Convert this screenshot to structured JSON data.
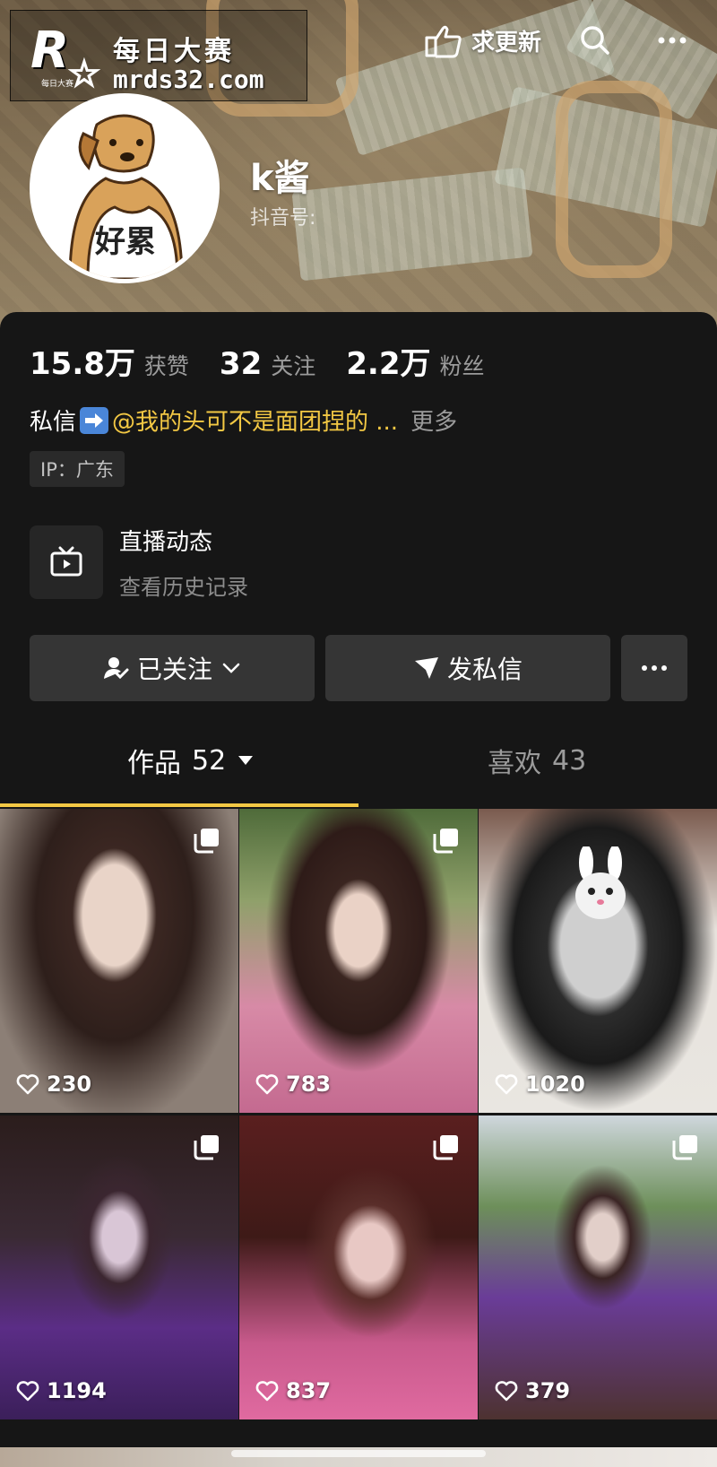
{
  "watermark": {
    "title": "每日大赛",
    "domain": "mrds32.com",
    "logo_small": "每日大赛"
  },
  "header": {
    "request_update": "求更新",
    "search_icon": "search-icon",
    "more_icon": "more-icon"
  },
  "profile": {
    "username": "k酱",
    "douyin_id_label": "抖音号:",
    "avatar_caption": "好累"
  },
  "stats": [
    {
      "num": "15.8万",
      "label": "获赞"
    },
    {
      "num": "32",
      "label": "关注"
    },
    {
      "num": "2.2万",
      "label": "粉丝"
    }
  ],
  "bio": {
    "prefix": "私信",
    "mention": "@我的头可不是面团捏的 ...",
    "more": "更多"
  },
  "ip": "IP：广东",
  "live": {
    "title": "直播动态",
    "subtitle": "查看历史记录"
  },
  "buttons": {
    "follow": "已关注",
    "message": "发私信"
  },
  "tabs": {
    "works": {
      "label": "作品",
      "count": "52"
    },
    "likes": {
      "label": "喜欢",
      "count": "43"
    }
  },
  "colors": {
    "accent": "#f3c844",
    "card_bg": "#161616",
    "button_bg": "#353535"
  },
  "videos": [
    {
      "likes": "230"
    },
    {
      "likes": "783"
    },
    {
      "likes": "1020"
    },
    {
      "likes": "1194"
    },
    {
      "likes": "837"
    },
    {
      "likes": "379"
    }
  ]
}
